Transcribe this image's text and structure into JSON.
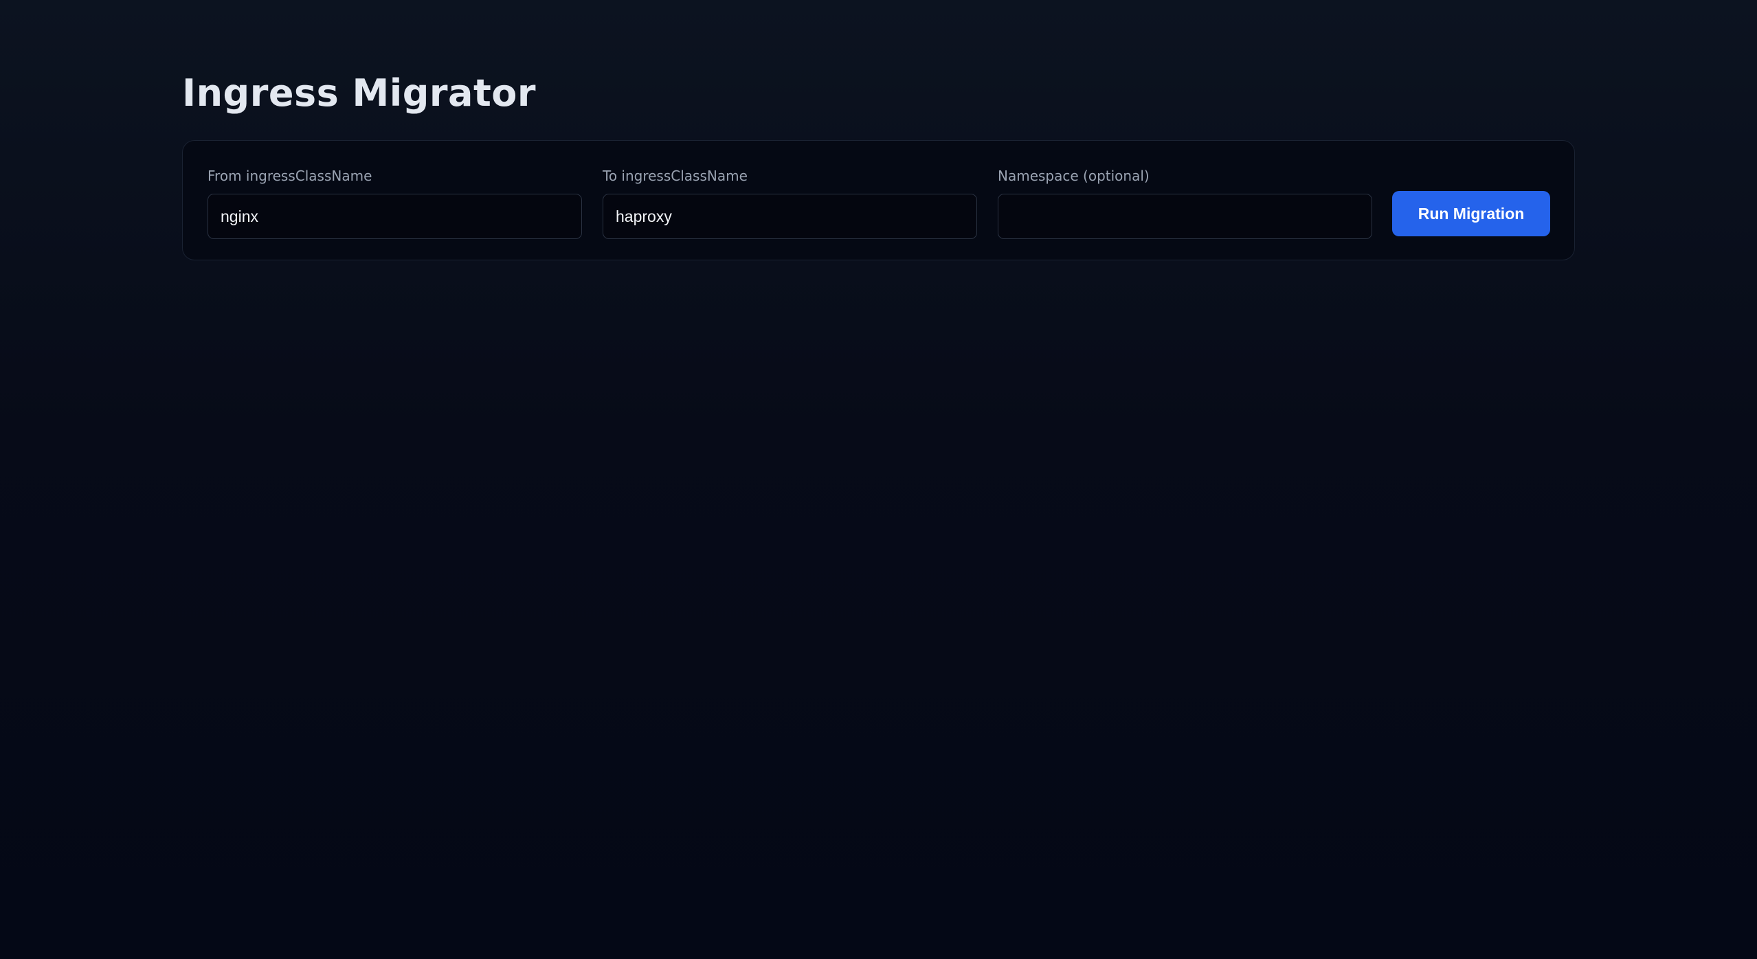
{
  "page": {
    "title": "Ingress Migrator"
  },
  "form": {
    "from": {
      "label": "From ingressClassName",
      "value": "nginx",
      "placeholder": ""
    },
    "to": {
      "label": "To ingressClassName",
      "value": "haproxy",
      "placeholder": ""
    },
    "namespace": {
      "label": "Namespace (optional)",
      "value": "",
      "placeholder": ""
    },
    "submit_label": "Run Migration"
  },
  "colors": {
    "background": "#070b18",
    "card": "#050914",
    "accent": "#2563eb"
  }
}
